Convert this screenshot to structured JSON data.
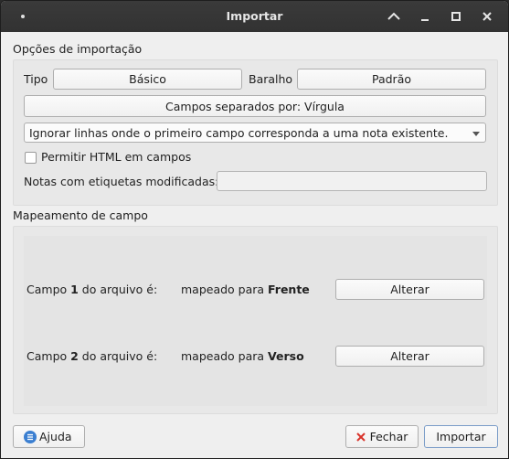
{
  "window": {
    "title": "Importar"
  },
  "import_options": {
    "group_title": "Opções de importação",
    "type_label": "Tipo",
    "type_value": "Básico",
    "deck_label": "Baralho",
    "deck_value": "Padrão",
    "separator_button": "Campos separados por: Vírgula",
    "duplicate_select": "Ignorar linhas onde o primeiro campo corresponda a uma nota existente.",
    "allow_html_label": "Permitir HTML em campos",
    "allow_html_checked": false,
    "tags_label": "Notas com etiquetas modificadas:",
    "tags_value": ""
  },
  "field_mapping": {
    "group_title": "Mapeamento de campo",
    "rows": [
      {
        "prefix": "Campo ",
        "num": "1",
        "suffix": " do arquivo é:",
        "mapped_prefix": "mapeado para ",
        "target": "Frente",
        "button": "Alterar"
      },
      {
        "prefix": "Campo ",
        "num": "2",
        "suffix": " do arquivo é:",
        "mapped_prefix": "mapeado para ",
        "target": "Verso",
        "button": "Alterar"
      }
    ]
  },
  "footer": {
    "help_label": "Ajuda",
    "close_label": "Fechar",
    "import_label": "Importar"
  },
  "colors": {
    "titlebar": "#333333",
    "window_bg": "#efefef",
    "close_icon": "#d9342b",
    "help_icon": "#3b7fd1"
  }
}
